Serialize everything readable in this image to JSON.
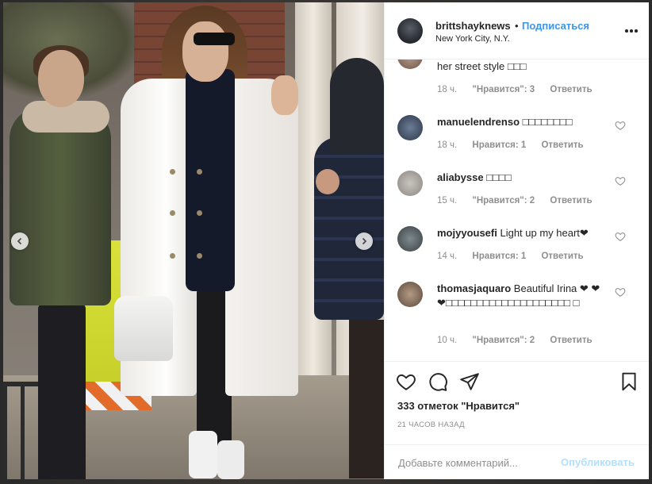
{
  "header": {
    "username": "brittshayknews",
    "separator": "•",
    "follow_label": "Подписаться",
    "location": "New York City, N.Y.",
    "avatar_icon": "user-avatar",
    "more_icon": "more-horizontal-icon"
  },
  "photo": {
    "prev_icon": "chevron-left-icon",
    "next_icon": "chevron-right-icon"
  },
  "comments": [
    {
      "username": "",
      "text": "her street style □□□",
      "time": "18 ч.",
      "likes": "\"Нравится\": 3",
      "reply": "Ответить"
    },
    {
      "username": "manuelendrenso",
      "text": " □□□□□□□□",
      "time": "18 ч.",
      "likes": "Нравится: 1",
      "reply": "Ответить"
    },
    {
      "username": "aliabysse",
      "text": " □□□□",
      "time": "15 ч.",
      "likes": "\"Нравится\": 2",
      "reply": "Ответить"
    },
    {
      "username": "mojyyousefi",
      "text": " Light up my heart❤",
      "time": "14 ч.",
      "likes": "Нравится: 1",
      "reply": "Ответить"
    },
    {
      "username": "thomasjaquaro",
      "text": " Beautiful Irina ❤ ❤❤□□□□□□□□□□□□□□□□□□□□ □",
      "time": "10 ч.",
      "likes": "\"Нравится\": 2",
      "reply": "Ответить"
    }
  ],
  "actions": {
    "like_icon": "heart-icon",
    "comment_icon": "comment-bubble-icon",
    "share_icon": "paper-plane-icon",
    "save_icon": "bookmark-icon",
    "likes_text": "333 отметок \"Нравится\"",
    "time_ago": "21 ЧАСОВ НАЗАД",
    "add_comment_placeholder": "Добавьте комментарий...",
    "publish_label": "Опубликовать"
  },
  "colors": {
    "link_blue": "#3897f0",
    "publish_disabled": "#b2dffc",
    "text_primary": "#262626",
    "text_secondary": "#8e8e8e"
  }
}
